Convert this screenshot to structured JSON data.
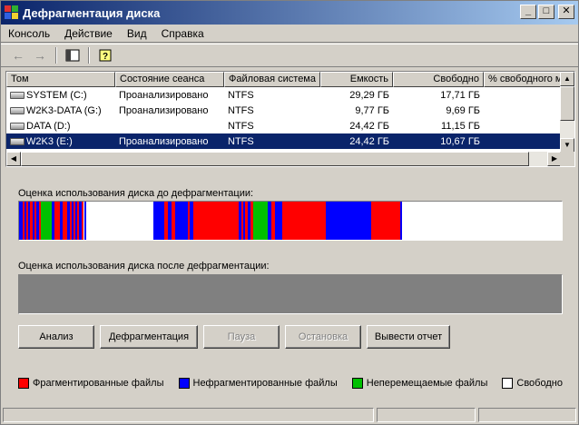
{
  "window": {
    "title": "Дефрагментация диска"
  },
  "menu": [
    {
      "label": "Консоль"
    },
    {
      "label": "Действие"
    },
    {
      "label": "Вид"
    },
    {
      "label": "Справка"
    }
  ],
  "columns": [
    "Том",
    "Состояние сеанса",
    "Файловая система",
    "Емкость",
    "Свободно",
    "% свободного м"
  ],
  "volumes": [
    {
      "name": "SYSTEM (C:)",
      "state": "Проанализировано",
      "fs": "NTFS",
      "capacity": "29,29 ГБ",
      "free": "17,71 ГБ"
    },
    {
      "name": "W2K3-DATA (G:)",
      "state": "Проанализировано",
      "fs": "NTFS",
      "capacity": "9,77 ГБ",
      "free": "9,69 ГБ"
    },
    {
      "name": "DATA (D:)",
      "state": "",
      "fs": "NTFS",
      "capacity": "24,42 ГБ",
      "free": "11,15 ГБ"
    },
    {
      "name": "W2K3 (E:)",
      "state": "Проанализировано",
      "fs": "NTFS",
      "capacity": "24,42 ГБ",
      "free": "10,67 ГБ"
    }
  ],
  "panel": {
    "before_label": "Оценка использования диска до дефрагментации:",
    "after_label": "Оценка использования диска после дефрагментации:"
  },
  "buttons": {
    "analyze": "Анализ",
    "defrag": "Дефрагментация",
    "pause": "Пауза",
    "stop": "Остановка",
    "report": "Вывести отчет"
  },
  "legend": {
    "fragmented": "Фрагментированные файлы",
    "contiguous": "Нефрагментированные файлы",
    "unmovable": "Неперемещаемые файлы",
    "free": "Свободно"
  },
  "colors": {
    "fragmented": "#ff0000",
    "contiguous": "#0000ff",
    "unmovable": "#00c000",
    "free": "#ffffff",
    "selection": "#0a246a",
    "title_start": "#0a246a"
  }
}
